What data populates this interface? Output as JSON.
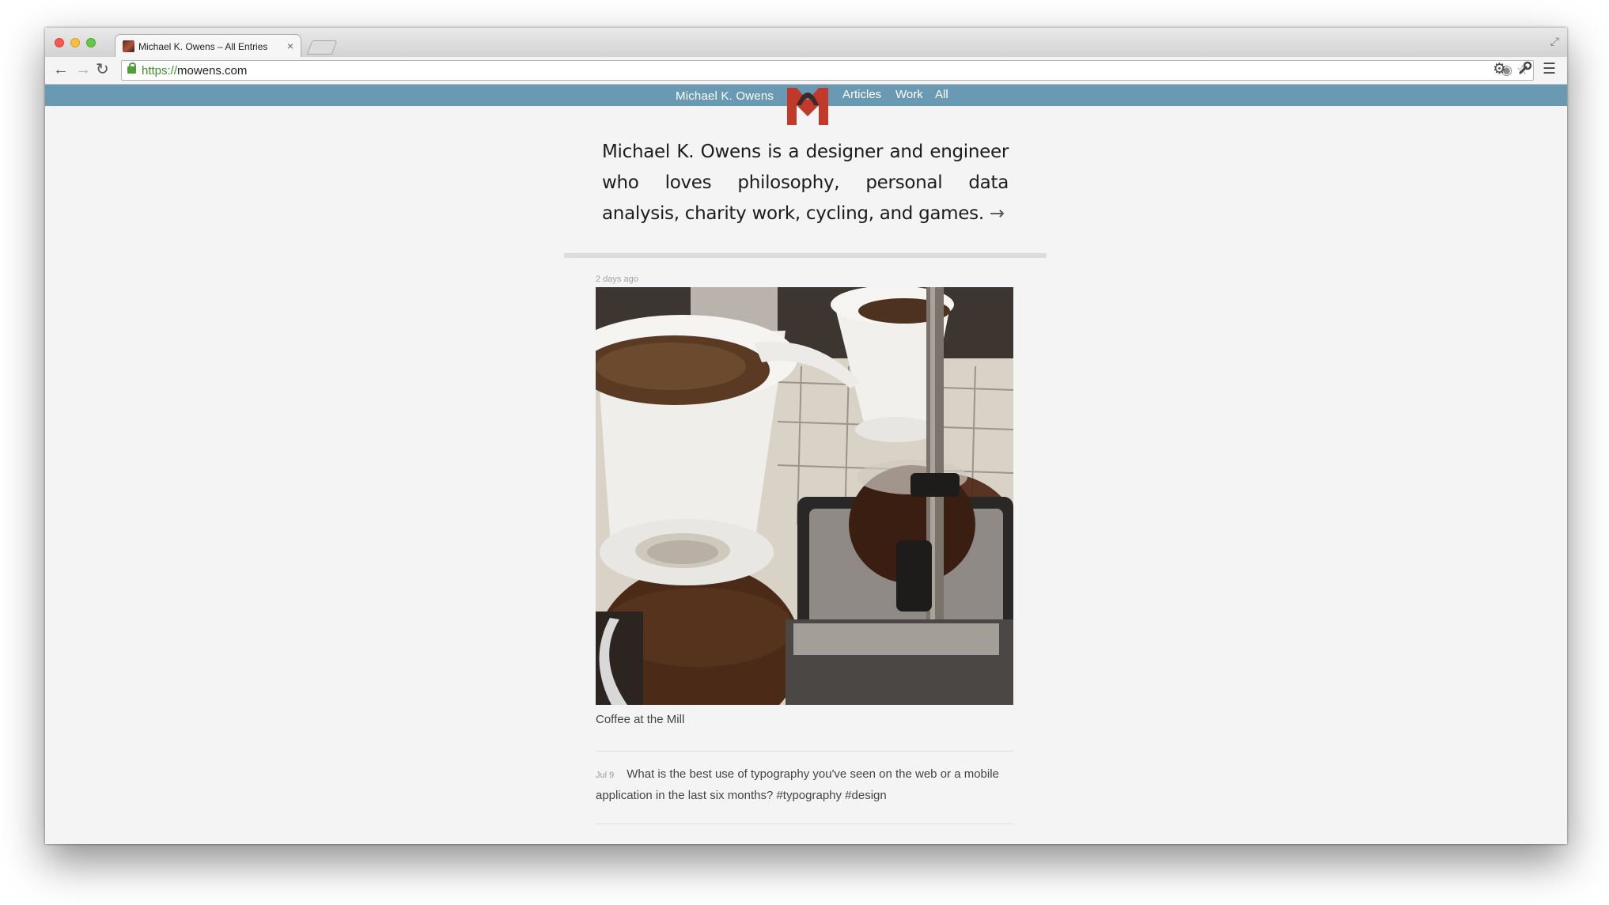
{
  "browser": {
    "tab_title": "Michael K. Owens – All Entries",
    "tab_close": "×",
    "url_scheme": "https://",
    "url_host": "mowens.com"
  },
  "site": {
    "name": "Michael K. Owens",
    "nav": [
      "Articles",
      "Work",
      "All"
    ],
    "brand_color": "#6a9ab3",
    "logo_color": "#c0392b"
  },
  "intro": {
    "text": "Michael K. Owens is a designer and engineer who loves philosophy, personal data analysis, charity work, cycling, and games.",
    "arrow": "→"
  },
  "entries": [
    {
      "date": "2 days ago",
      "type": "photo",
      "caption": "Coffee at the Mill"
    },
    {
      "date": "Jul 9",
      "type": "text",
      "text": "What is the best use of typography you've seen on the web or a mobile application in the last six months? #typography #design"
    }
  ]
}
